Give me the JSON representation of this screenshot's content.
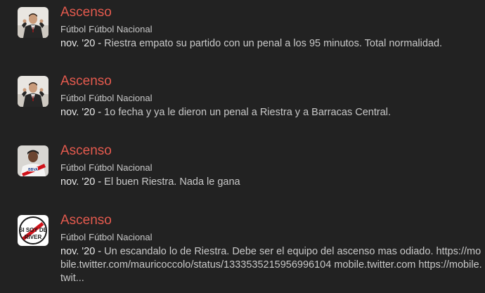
{
  "results": [
    {
      "title": "Ascenso",
      "categories": [
        "Fútbol",
        "Fútbol Nacional"
      ],
      "date": "nov. '20",
      "separator": " - ",
      "excerpt": "Riestra empato su partido con un penal a los 95 minutos. Total normalidad.",
      "avatar": "avatar-man-in-suit"
    },
    {
      "title": "Ascenso",
      "categories": [
        "Fútbol",
        "Fútbol Nacional"
      ],
      "date": "nov. '20",
      "separator": " - ",
      "excerpt": "1o fecha y ya le dieron un penal a Riestra y a Barracas Central.",
      "avatar": "avatar-man-in-suit"
    },
    {
      "title": "Ascenso",
      "categories": [
        "Fútbol",
        "Fútbol Nacional"
      ],
      "date": "nov. '20",
      "separator": " - ",
      "excerpt": "El buen Riestra. Nada le gana",
      "avatar": "avatar-river-player"
    },
    {
      "title": "Ascenso",
      "categories": [
        "Fútbol",
        "Fútbol Nacional"
      ],
      "date": "nov. '20",
      "separator": " - ",
      "excerpt": "Un escandalo lo de Riestra. Debe ser el equipo del ascenso mas odiado. https://mobile.twitter.com/mauricoccolo/status/1333535215956996104 mobile.twitter.com https://mobile.twit...",
      "avatar": "avatar-si-soy-de-river",
      "avatar_text": [
        "SI SOY DE",
        "RIVER"
      ]
    }
  ],
  "colors": {
    "background": "#222222",
    "title": "#e45a4e",
    "text": "#c9c9c9"
  }
}
